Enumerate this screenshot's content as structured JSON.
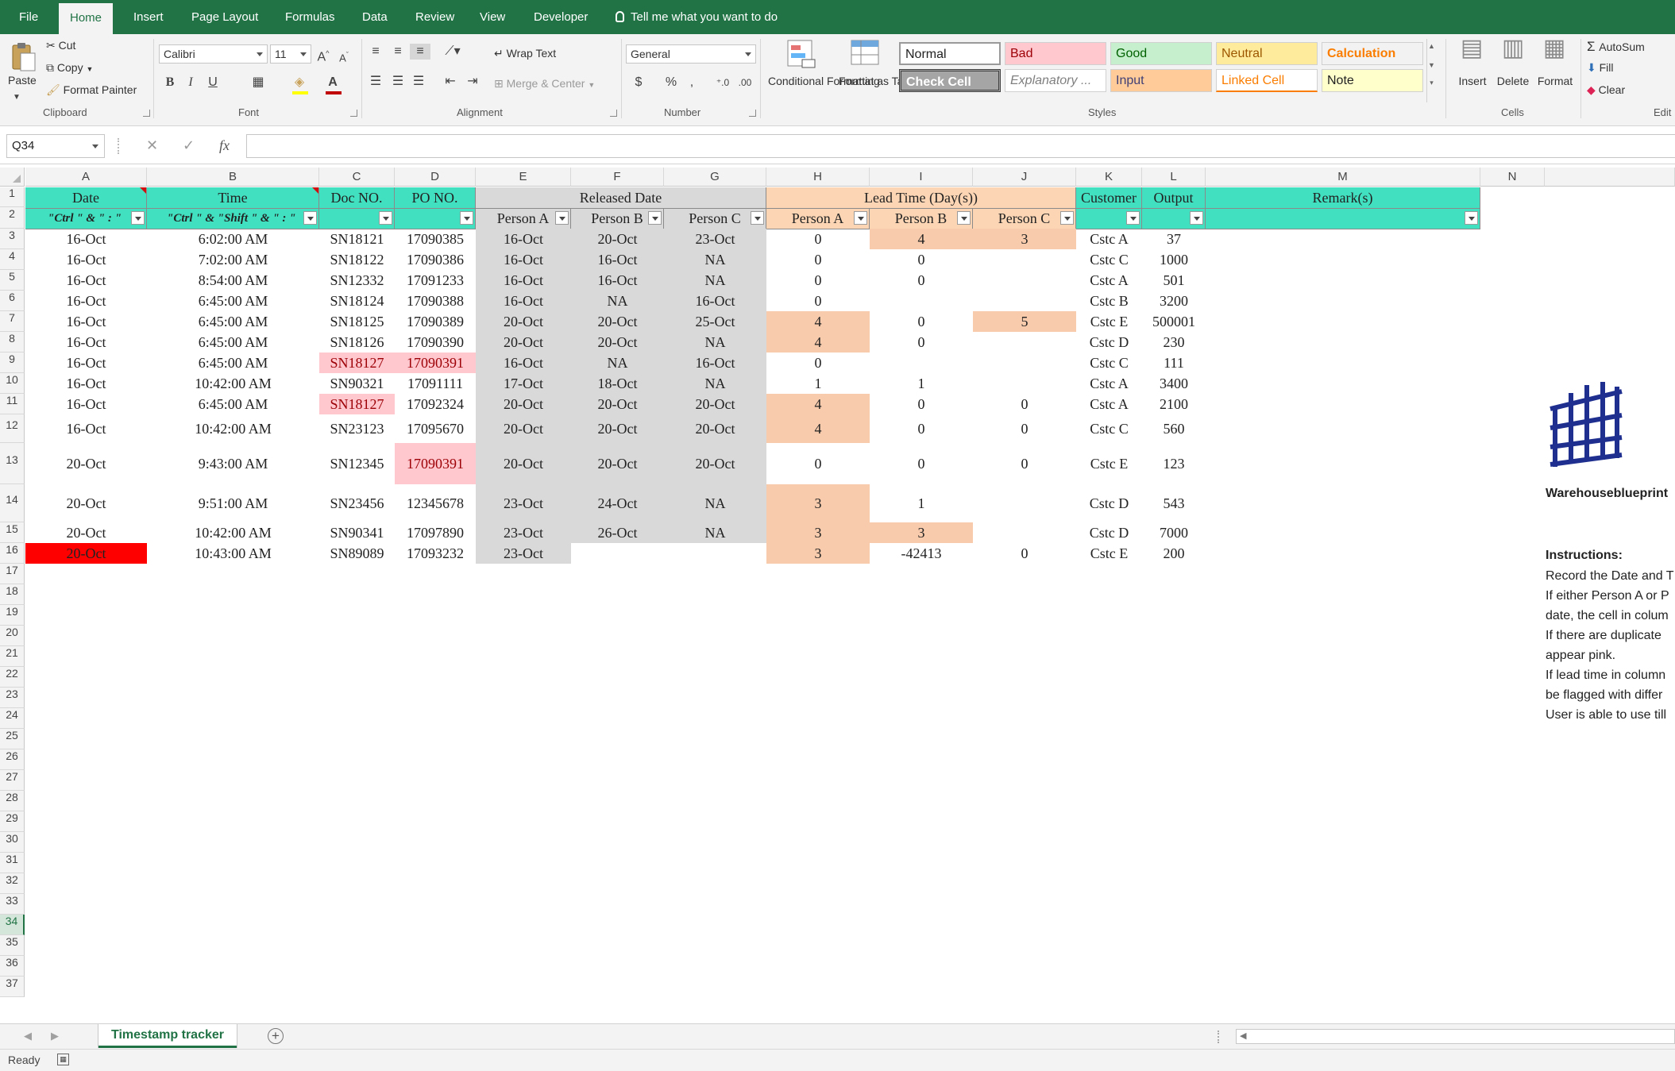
{
  "ribbon": {
    "tabs": [
      "File",
      "Home",
      "Insert",
      "Page Layout",
      "Formulas",
      "Data",
      "Review",
      "View",
      "Developer"
    ],
    "active_tab": "Home",
    "tell_me": "Tell me what you want to do",
    "clipboard": {
      "paste": "Paste",
      "cut": "Cut",
      "copy": "Copy",
      "format_painter": "Format Painter",
      "group": "Clipboard"
    },
    "font": {
      "name": "Calibri",
      "size": "11",
      "bold": "B",
      "italic": "I",
      "underline": "U",
      "group": "Font"
    },
    "alignment": {
      "wrap_text": "Wrap Text",
      "merge_center": "Merge & Center",
      "group": "Alignment"
    },
    "number": {
      "format": "General",
      "currency": "$",
      "percent": "%",
      "comma": ",",
      "group": "Number"
    },
    "styles": {
      "conditional_formatting": "Conditional Formatting",
      "format_as_table": "Format as Table",
      "group": "Styles",
      "gallery": [
        {
          "label": "Normal",
          "bg": "#ffffff",
          "fg": "#222222"
        },
        {
          "label": "Bad",
          "bg": "#ffc7ce",
          "fg": "#9c0006"
        },
        {
          "label": "Good",
          "bg": "#c6efce",
          "fg": "#006100"
        },
        {
          "label": "Neutral",
          "bg": "#ffeb9c",
          "fg": "#9c5700"
        },
        {
          "label": "Calculation",
          "bg": "#f2f2f2",
          "fg": "#fa7d00"
        },
        {
          "label": "Check Cell",
          "bg": "#a5a5a5",
          "fg": "#ffffff"
        },
        {
          "label": "Explanatory ...",
          "bg": "#ffffff",
          "fg": "#7f7f7f"
        },
        {
          "label": "Input",
          "bg": "#ffcc99",
          "fg": "#3f3f76"
        },
        {
          "label": "Linked Cell",
          "bg": "#ffffff",
          "fg": "#fa7d00"
        },
        {
          "label": "Note",
          "bg": "#ffffcc",
          "fg": "#222222"
        }
      ]
    },
    "cells": {
      "insert": "Insert",
      "delete": "Delete",
      "format": "Format",
      "group": "Cells"
    },
    "editing": {
      "autosum": "AutoSum",
      "fill": "Fill",
      "clear": "Clear",
      "group": "Edit"
    }
  },
  "formula_bar": {
    "name_box": "Q34",
    "cancel": "✕",
    "enter": "✓",
    "fx": "fx",
    "value": ""
  },
  "columns": [
    "A",
    "B",
    "C",
    "D",
    "E",
    "F",
    "G",
    "H",
    "I",
    "J",
    "K",
    "L",
    "M",
    "N"
  ],
  "rows": [
    "1",
    "2",
    "3",
    "4",
    "5",
    "6",
    "7",
    "8",
    "9",
    "10",
    "11",
    "12",
    "13",
    "14",
    "15",
    "16",
    "17",
    "18",
    "19",
    "20",
    "21",
    "22",
    "23",
    "24",
    "25",
    "26",
    "27",
    "28",
    "29",
    "30",
    "31",
    "32",
    "33",
    "34",
    "35",
    "36",
    "37"
  ],
  "selected_row": "34",
  "header": {
    "date": "Date",
    "time": "Time",
    "doc_no": "Doc NO.",
    "po_no": "PO NO.",
    "released_date": "Released  Date",
    "lead_time": "Lead Time (Day(s))",
    "customer": "Customer",
    "output": "Output",
    "remarks": "Remark(s)",
    "date_hint": "\"Ctrl \" & \" : \"",
    "time_hint": "\"Ctrl \" & \"Shift \" & \" : \"",
    "person_a": "Person A",
    "person_b": "Person B",
    "person_c": "Person C"
  },
  "table": [
    [
      "16-Oct",
      "6:02:00 AM",
      "SN18121",
      "17090385",
      "16-Oct",
      "20-Oct",
      "23-Oct",
      "0",
      "4",
      "3",
      "Cstc A",
      "37"
    ],
    [
      "16-Oct",
      "7:02:00 AM",
      "SN18122",
      "17090386",
      "16-Oct",
      "16-Oct",
      "NA",
      "0",
      "0",
      "",
      "Cstc C",
      "1000"
    ],
    [
      "16-Oct",
      "8:54:00 AM",
      "SN12332",
      "17091233",
      "16-Oct",
      "16-Oct",
      "NA",
      "0",
      "0",
      "",
      "Cstc A",
      "501"
    ],
    [
      "16-Oct",
      "6:45:00 AM",
      "SN18124",
      "17090388",
      "16-Oct",
      "NA",
      "16-Oct",
      "0",
      "",
      "",
      "Cstc B",
      "3200"
    ],
    [
      "16-Oct",
      "6:45:00 AM",
      "SN18125",
      "17090389",
      "20-Oct",
      "20-Oct",
      "25-Oct",
      "4",
      "0",
      "5",
      "Cstc E",
      "500001"
    ],
    [
      "16-Oct",
      "6:45:00 AM",
      "SN18126",
      "17090390",
      "20-Oct",
      "20-Oct",
      "NA",
      "4",
      "0",
      "",
      "Cstc D",
      "230"
    ],
    [
      "16-Oct",
      "6:45:00 AM",
      "SN18127",
      "17090391",
      "16-Oct",
      "NA",
      "16-Oct",
      "0",
      "",
      "",
      "Cstc C",
      "111"
    ],
    [
      "16-Oct",
      "10:42:00 AM",
      "SN90321",
      "17091111",
      "17-Oct",
      "18-Oct",
      "NA",
      "1",
      "1",
      "",
      "Cstc A",
      "3400"
    ],
    [
      "16-Oct",
      "6:45:00 AM",
      "SN18127",
      "17092324",
      "20-Oct",
      "20-Oct",
      "20-Oct",
      "4",
      "0",
      "0",
      "Cstc A",
      "2100"
    ],
    [
      "16-Oct",
      "10:42:00 AM",
      "SN23123",
      "17095670",
      "20-Oct",
      "20-Oct",
      "20-Oct",
      "4",
      "0",
      "0",
      "Cstc C",
      "560"
    ],
    [
      "20-Oct",
      "9:43:00 AM",
      "SN12345",
      "17090391",
      "20-Oct",
      "20-Oct",
      "20-Oct",
      "0",
      "0",
      "0",
      "Cstc E",
      "123"
    ],
    [
      "20-Oct",
      "9:51:00 AM",
      "SN23456",
      "12345678",
      "23-Oct",
      "24-Oct",
      "NA",
      "3",
      "1",
      "",
      "Cstc D",
      "543"
    ],
    [
      "20-Oct",
      "10:42:00 AM",
      "SN90341",
      "17097890",
      "23-Oct",
      "26-Oct",
      "NA",
      "3",
      "3",
      "",
      "Cstc D",
      "7000"
    ],
    [
      "20-Oct",
      "10:43:00 AM",
      "SN89089",
      "17093232",
      "23-Oct",
      "",
      "",
      "3",
      "-42413",
      "0",
      "Cstc E",
      "200"
    ]
  ],
  "colors": {
    "teal_header": "#40e0c0",
    "peach_header": "#fcd5b4",
    "gray_header": "#d9d9d9",
    "gray_fill": "#d9d9d9",
    "orange_fill": "#f8cbad",
    "pink_fill": "#ffc7ce",
    "pink_text": "#9c0006",
    "red_fill": "#ff0000",
    "excel_green": "#217346"
  },
  "side_panel": {
    "logo_title": "Warehouseblueprint",
    "instructions_title": "Instructions:",
    "lines": [
      "Record the Date and T",
      "If either Person A or P",
      "date, the cell in colum",
      "If there are duplicate",
      "appear pink.",
      "If lead time in column",
      "be flagged with differ",
      "User is able to use till"
    ]
  },
  "sheet": {
    "tab": "Timestamp tracker",
    "add": "+"
  },
  "status": {
    "ready": "Ready"
  }
}
